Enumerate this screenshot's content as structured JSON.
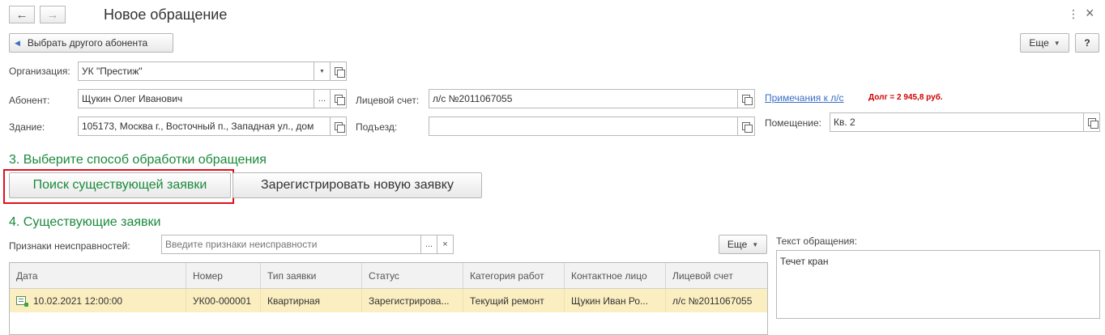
{
  "header": {
    "title": "Новое обращение",
    "back_icon": "←",
    "forward_icon": "→",
    "more_icon": "⋮",
    "close_icon": "×"
  },
  "toolbar": {
    "select_other_label": "Выбрать другого абонента",
    "more_label": "Еще",
    "help_label": "?"
  },
  "form": {
    "organization_label": "Организация:",
    "organization_value": "УК \"Престиж\"",
    "subscriber_label": "Абонент:",
    "subscriber_value": "Щукин Олег Иванович",
    "building_label": "Здание:",
    "building_value": "105173, Москва г., Восточный п., Западная ул., дом",
    "account_label": "Лицевой счет:",
    "account_value": "л/с №2011067055",
    "entrance_label": "Подъезд:",
    "entrance_value": "",
    "notes_link": "Примечания к л/с",
    "debt_text": "Долг = 2 945,8 руб.",
    "room_label": "Помещение:",
    "room_value": "Кв. 2"
  },
  "section3": {
    "title": "3. Выберите способ обработки обращения",
    "search_existing_label": "Поиск существующей заявки",
    "register_new_label": "Зарегистрировать новую заявку"
  },
  "section4": {
    "title": "4. Существующие заявки",
    "faults_label": "Признаки неисправностей:",
    "faults_placeholder": "Введите признаки неисправности",
    "more_label": "Еще",
    "columns": [
      "Дата",
      "Номер",
      "Тип заявки",
      "Статус",
      "Категория работ",
      "Контактное лицо",
      "Лицевой счет"
    ],
    "rows": [
      [
        "10.02.2021 12:00:00",
        "УК00-000001",
        "Квартирная",
        "Зарегистрирова...",
        "Текущий ремонт",
        "Щукин Иван Ро...",
        "л/с №2011067055"
      ]
    ]
  },
  "request_text": {
    "label": "Текст обращения:",
    "value": "Течет кран"
  },
  "colors": {
    "section_green": "#1a8a3c",
    "highlight_red": "#e0101b",
    "row_selected": "#fbeec0",
    "debt_red": "#d00000",
    "link_blue": "#3a6fc4"
  }
}
